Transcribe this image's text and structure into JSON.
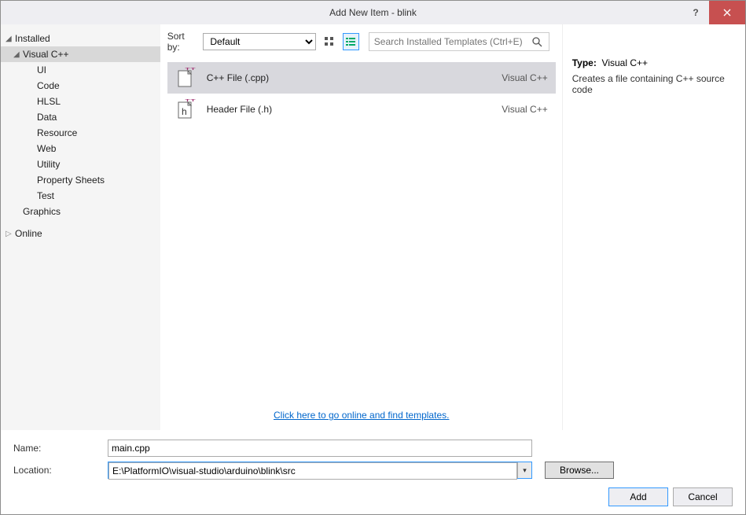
{
  "window": {
    "title": "Add New Item - blink"
  },
  "nav": {
    "installed": "Installed",
    "visualcpp": "Visual C++",
    "items": [
      "UI",
      "Code",
      "HLSL",
      "Data",
      "Resource",
      "Web",
      "Utility",
      "Property Sheets",
      "Test"
    ],
    "graphics": "Graphics",
    "online": "Online"
  },
  "toolbar": {
    "sortLabel": "Sort by:",
    "sortValue": "Default",
    "searchPlaceholder": "Search Installed Templates (Ctrl+E)"
  },
  "templates": [
    {
      "name": "C++ File (.cpp)",
      "lang": "Visual C++",
      "selected": true
    },
    {
      "name": "Header File (.h)",
      "lang": "Visual C++",
      "selected": false
    }
  ],
  "onlineLink": "Click here to go online and find templates.",
  "info": {
    "typeLabel": "Type:",
    "typeValue": "Visual C++",
    "description": "Creates a file containing C++ source code"
  },
  "form": {
    "nameLabel": "Name:",
    "nameValue": "main.cpp",
    "locationLabel": "Location:",
    "locationValue": "E:\\PlatformIO\\visual-studio\\arduino\\blink\\src",
    "browse": "Browse...",
    "add": "Add",
    "cancel": "Cancel"
  }
}
